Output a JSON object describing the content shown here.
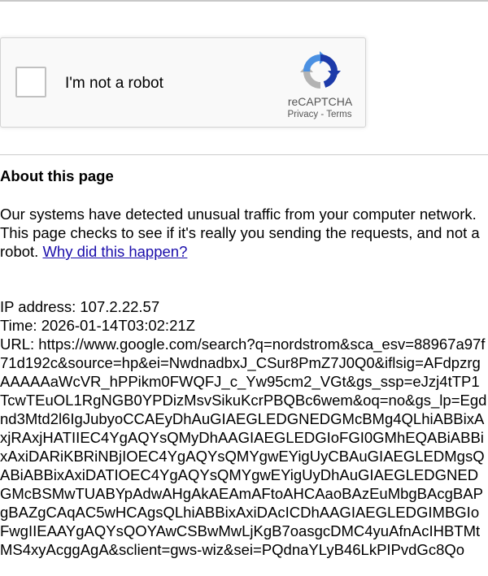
{
  "captcha": {
    "label": "I'm not a robot",
    "brand": "reCAPTCHA",
    "privacy": "Privacy",
    "separator": " - ",
    "terms": "Terms",
    "colors": {
      "logo_blue": "#4a90e2",
      "logo_dark_blue": "#1c3aa9",
      "logo_gray": "#b3b3b3"
    },
    "icon": "recaptcha-logo"
  },
  "about": {
    "title": "About this page",
    "body": "Our systems have detected unusual traffic from your computer network. This page checks to see if it's really you sending the requests, and not a robot. ",
    "link": "Why did this happen?"
  },
  "info": {
    "ip": "IP address: 107.2.22.57",
    "time": "Time: 2026-01-14T03:02:21Z",
    "url": "URL: https://www.google.com/search?q=nordstrom&sca_esv=88967a97f71d192c&source=hp&ei=NwdnadbxJ_CSur8PmZ7J0Q0&iflsig=AFdpzrgAAAAAaWcVR_hPPikm0FWQFJ_c_Yw95cm2_VGt&gs_ssp=eJzj4tTP1TcwTEuOL1RgNGB0YPDizMsvSikuKcrPBQBc6wem&oq=no&gs_lp=Egdnd3Mtd2l6IgJubyoCCAEyDhAuGIAEGLEDGNEDGMcBMg4QLhiABBixAxjRAxjHATIIEC4YgAQYsQMyDhAAGIAEGLEDGIoFGI0GMhEQABiABBixAxiDARiKBRiNBjIOEC4YgAQYsQMYgwEYigUyCBAuGIAEGLEDMgsQABiABBixAxiDATIOEC4YgAQYsQMYgwEYigUyDhAuGIAEGLEDGNEDGMcBSMwTUABYpAdwAHgAkAEAmAFtoAHCAaoBAzEuMbgBAcgBAPgBAZgCAqAC5wHCAgsQLhiABBixAxiDAcICDhAAGIAEGLEDGIMBGIoFwgIIEAAYgAQYsQOYAwCSBwMwLjKgB7oasgcDMC4yuAfnAcIHBTMtMS4xyAcggAgA&sclient=gws-wiz&sei=PQdnaYLyB46LkPIPvdGc8Qo"
  }
}
